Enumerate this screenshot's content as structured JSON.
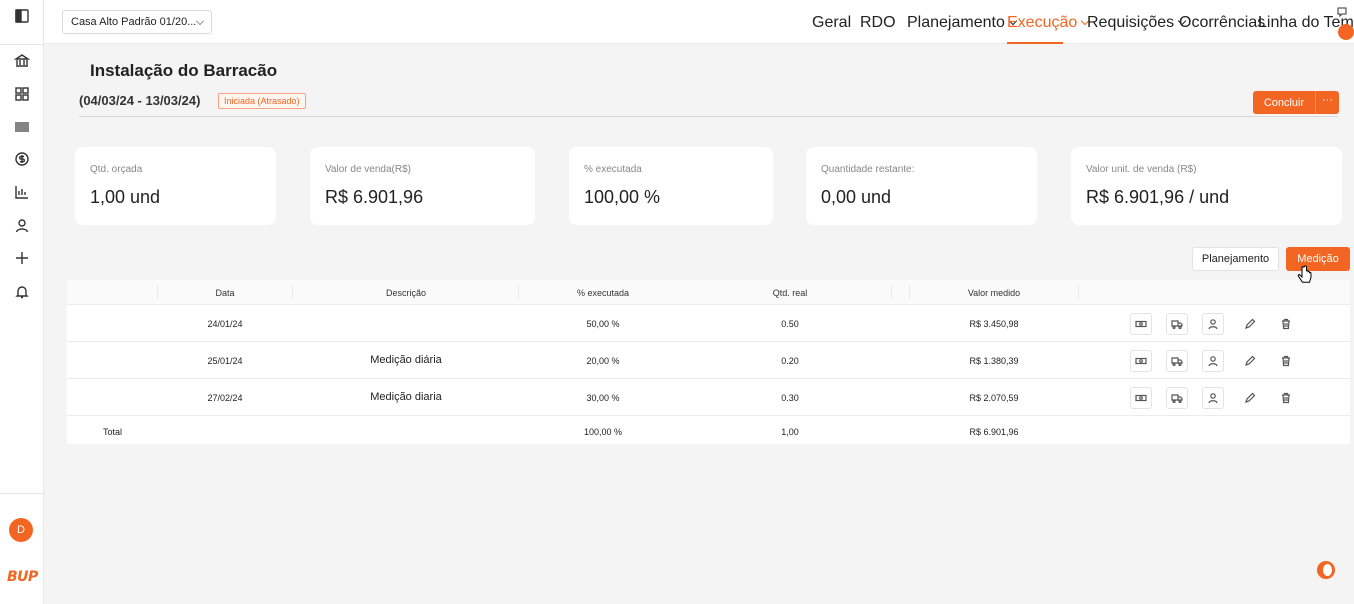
{
  "project": {
    "selected": "Casa Alto Padrão 01/20..."
  },
  "nav": {
    "items": [
      "Geral",
      "RDO",
      "Planejamento",
      "Execução",
      "Requisições",
      "Ocorrências",
      "Linha do Tempo"
    ],
    "active": "Execução"
  },
  "header": {
    "title": "Instalação do Barracão",
    "date_range": "(04/03/24 - 13/03/24)",
    "status": "Iniciada (Atrasado)",
    "conclude_label": "Concluir",
    "more_label": "···"
  },
  "cards": [
    {
      "label": "Qtd. orçada",
      "value": "1,00 und"
    },
    {
      "label": "Valor de venda(R$)",
      "value": "R$ 6.901,96"
    },
    {
      "label": "% executada",
      "value": "100,00 %"
    },
    {
      "label": "Quantidade restante:",
      "value": "0,00 und"
    },
    {
      "label": "Valor unit. de venda (R$)",
      "value": "R$ 6.901,96 / und"
    }
  ],
  "view_toggle": {
    "planning": "Planejamento",
    "measurement": "Medição"
  },
  "table": {
    "headers": [
      "Data",
      "Descrição",
      "% executada",
      "Qtd. real",
      "Valor medido"
    ],
    "rows": [
      {
        "date": "24/01/24",
        "description": "",
        "percent": "50,00 %",
        "qty": "0.50",
        "value": "R$ 3.450,98"
      },
      {
        "date": "25/01/24",
        "description": "Medição diária",
        "percent": "20,00 %",
        "qty": "0.20",
        "value": "R$ 1.380,39"
      },
      {
        "date": "27/02/24",
        "description": "Medição diaria",
        "percent": "30,00 %",
        "qty": "0.30",
        "value": "R$ 2.070,59"
      }
    ],
    "total": {
      "label": "Total",
      "percent": "100,00 %",
      "qty": "1,00",
      "value": "R$ 6.901,96"
    }
  },
  "user": {
    "initial": "D"
  },
  "brand": {
    "logo_text": "BUP",
    "accent": "#f26522"
  }
}
